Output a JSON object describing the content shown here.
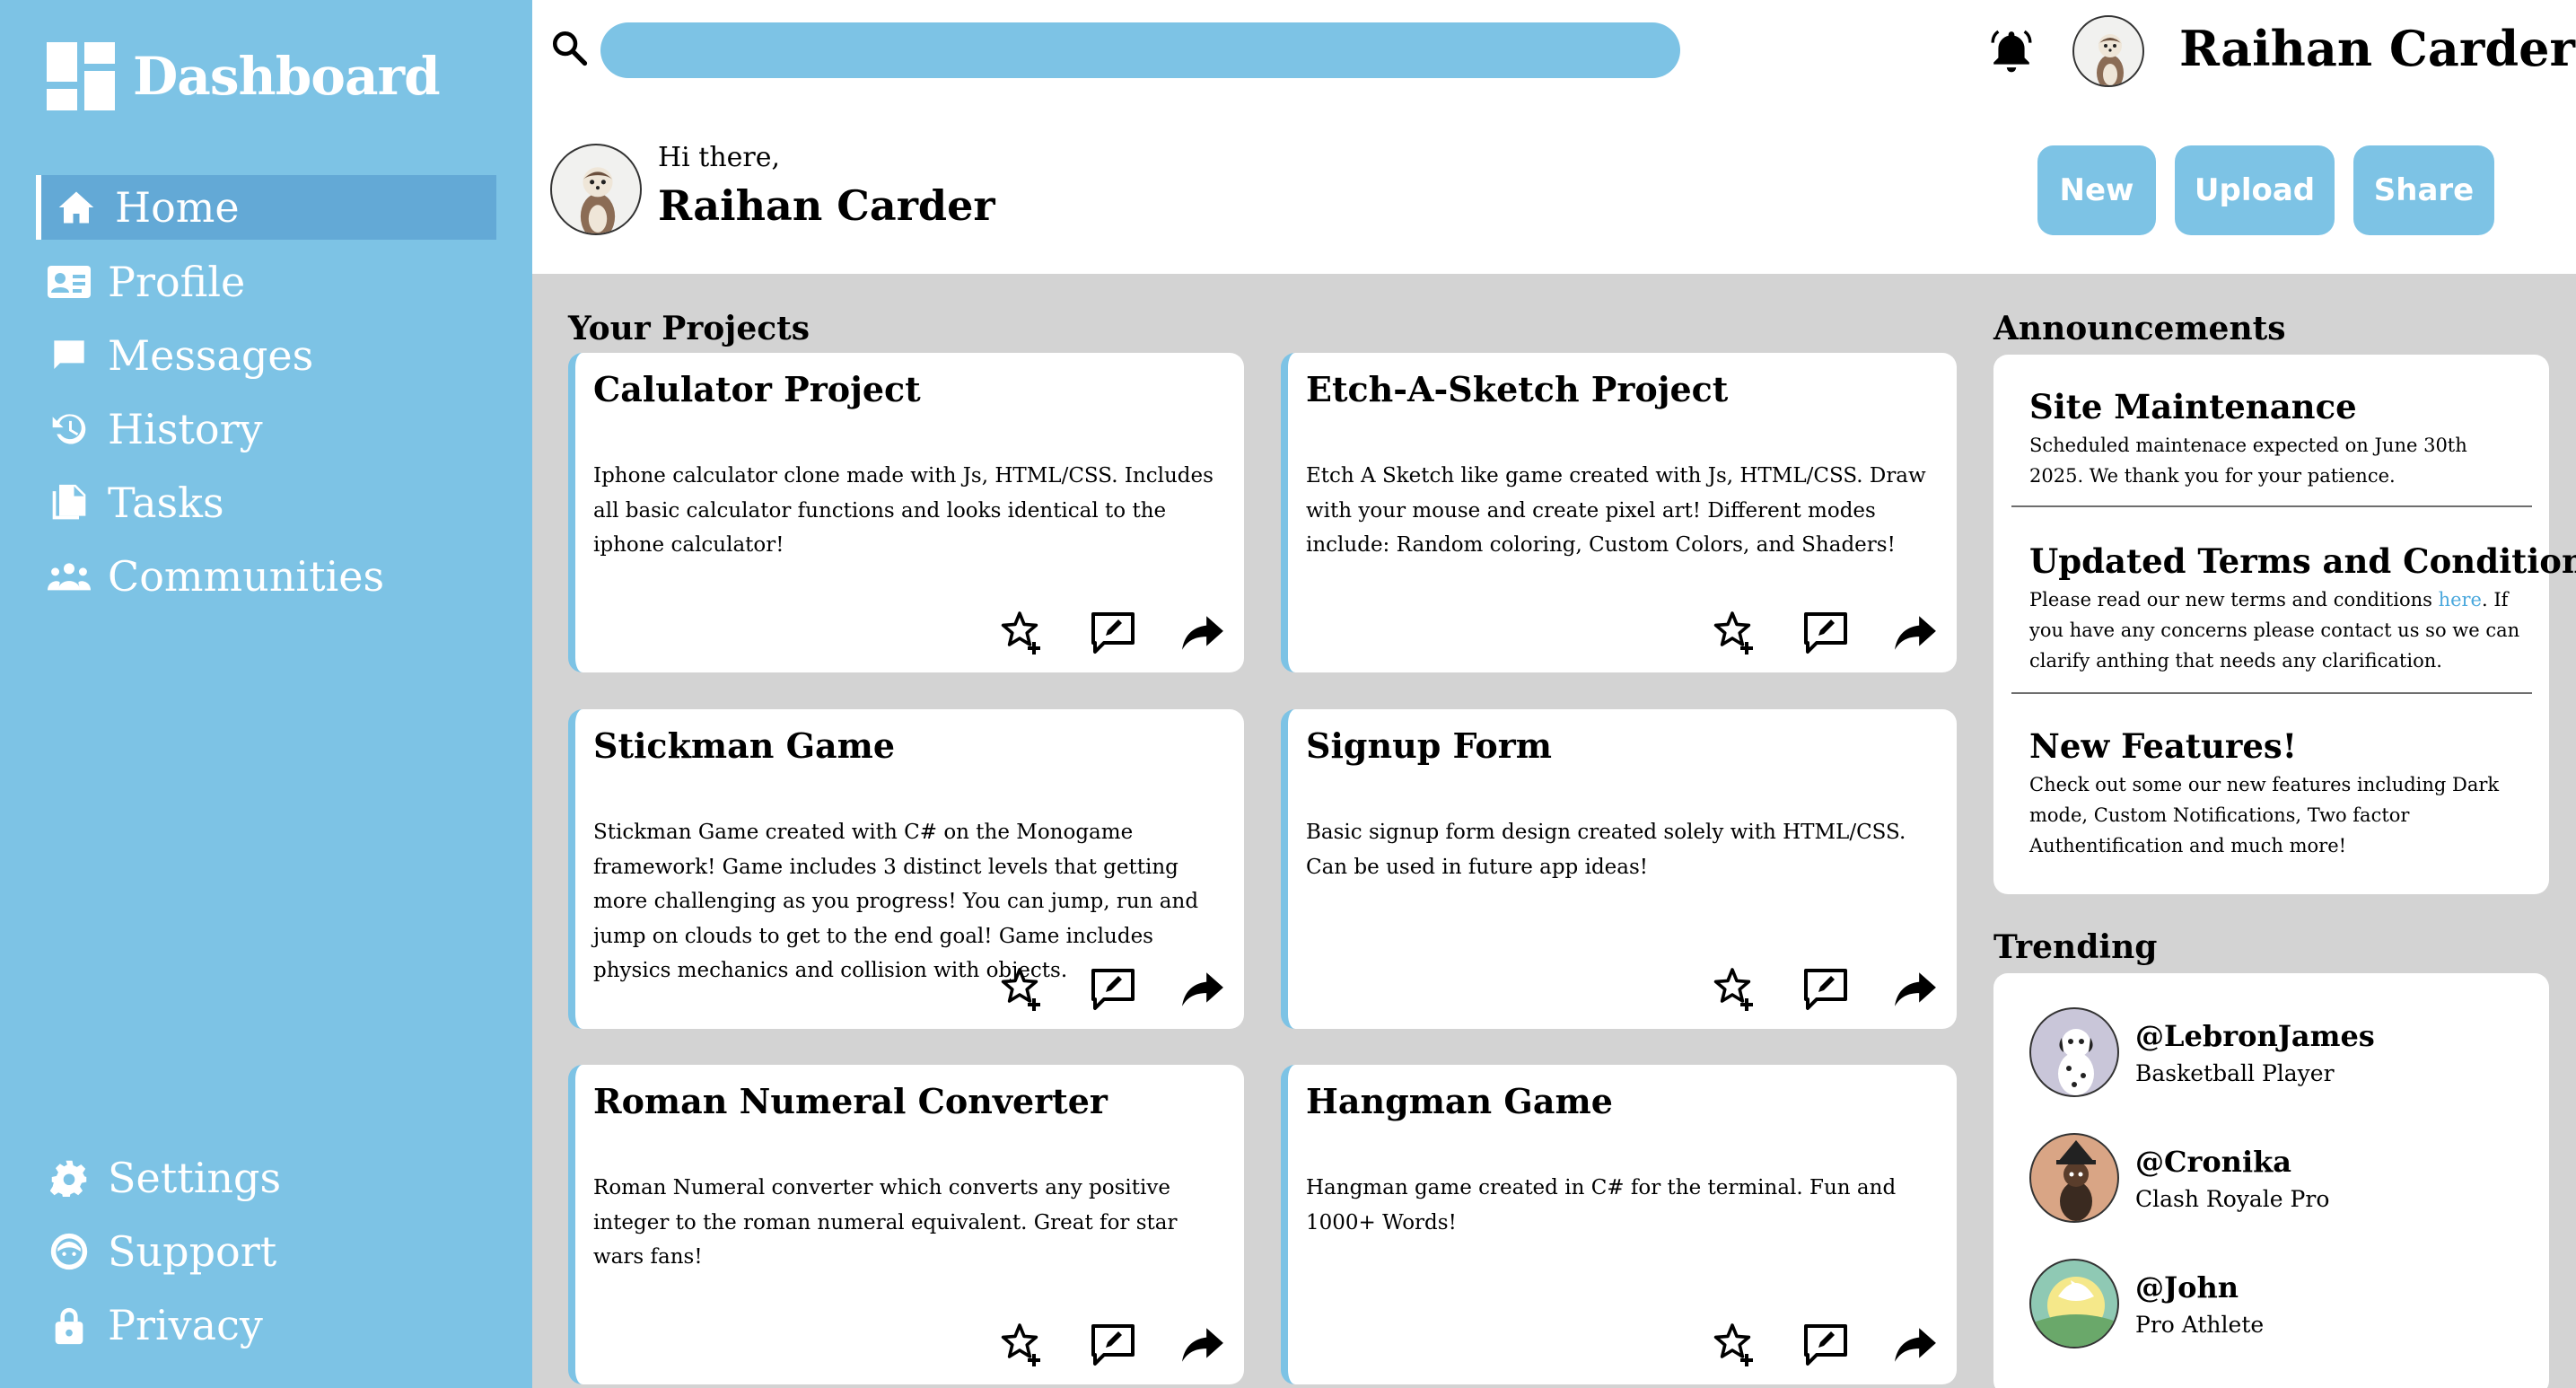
{
  "sidebar": {
    "logo_text": "Dashboard",
    "nav": [
      {
        "label": "Home",
        "icon": "home-icon",
        "active": true
      },
      {
        "label": "Profile",
        "icon": "id-card-icon"
      },
      {
        "label": "Messages",
        "icon": "chat-bubble-icon"
      },
      {
        "label": "History",
        "icon": "history-icon"
      },
      {
        "label": "Tasks",
        "icon": "documents-icon"
      },
      {
        "label": "Communities",
        "icon": "people-icon"
      }
    ],
    "bottom_nav": [
      {
        "label": "Settings",
        "icon": "gear-icon"
      },
      {
        "label": "Support",
        "icon": "support-icon"
      },
      {
        "label": "Privacy",
        "icon": "lock-icon"
      }
    ]
  },
  "header": {
    "search_placeholder": "",
    "user_name": "Raihan Carder",
    "greeting": "Hi there,",
    "greeting_name": "Raihan Carder",
    "buttons": {
      "new": "New",
      "upload": "Upload",
      "share": "Share"
    }
  },
  "projects": {
    "title": "Your Projects",
    "items": [
      {
        "title": "Calulator Project",
        "description": "Iphone calculator clone made with Js, HTML/CSS. Includes all basic calculator functions and looks identical to the iphone calculator!"
      },
      {
        "title": "Etch-A-Sketch Project",
        "description": "Etch A Sketch like game created with Js, HTML/CSS. Draw with your mouse and create pixel art! Different modes include: Random coloring, Custom Colors, and Shaders!"
      },
      {
        "title": "Stickman Game",
        "description": "Stickman Game created with C# on the Monogame framework! Game includes 3 distinct levels that getting more challenging as you progress! You can jump, run and jump on clouds to get to the end goal! Game includes physics mechanics and collision with objects."
      },
      {
        "title": "Signup Form",
        "description": "Basic signup form design created solely with HTML/CSS. Can be used in future app ideas!"
      },
      {
        "title": "Roman Numeral Converter",
        "description": "Roman Numeral converter which converts any positive integer to the roman numeral equivalent. Great for star wars fans!"
      },
      {
        "title": "Hangman Game",
        "description": "Hangman game created in C# for the terminal. Fun and 1000+ Words!"
      }
    ]
  },
  "announcements": {
    "title": "Announcements",
    "items": [
      {
        "title": "Site Maintenance",
        "text": "Scheduled maintenace expected on June 30th 2025. We thank you for your patience."
      },
      {
        "title": "Updated Terms and Conditions",
        "text_before": "Please read our new terms and conditions ",
        "link": "here",
        "text_after": ". If you have any concerns please contact us so we can clarify anthing that needs any clarification."
      },
      {
        "title": "New Features!",
        "text": "Check out some our new features including Dark mode, Custom Notifications, Two factor Authentification and much more!"
      }
    ]
  },
  "trending": {
    "title": "Trending",
    "items": [
      {
        "handle": "@LebronJames",
        "role": "Basketball Player"
      },
      {
        "handle": "@Cronika",
        "role": "Clash Royale Pro"
      },
      {
        "handle": "@John",
        "role": "Pro Athlete"
      }
    ]
  },
  "colors": {
    "accent": "#7dc3e5",
    "sidebar_active": "#63a9d6",
    "background": "#d3d3d3",
    "link": "#4aa8dd"
  }
}
